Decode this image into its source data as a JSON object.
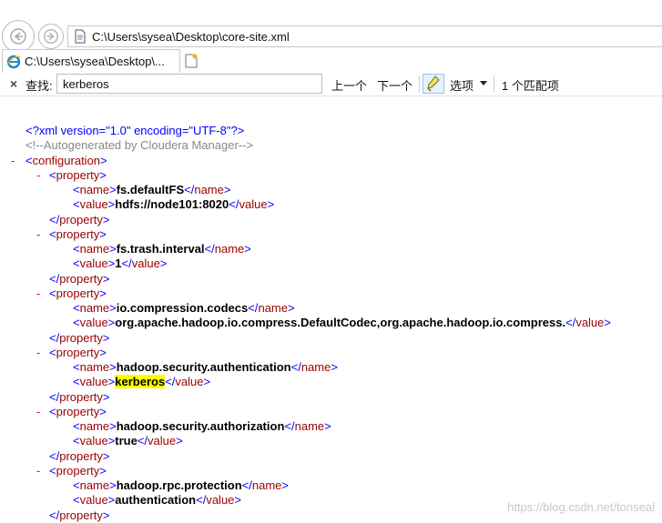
{
  "address_bar": {
    "url": "C:\\Users\\sysea\\Desktop\\core-site.xml"
  },
  "tab": {
    "title": "C:\\Users\\sysea\\Desktop\\..."
  },
  "find_bar": {
    "label": "查找:",
    "query": "kerberos",
    "prev_label": "上一个",
    "next_label": "下一个",
    "options_label": "选项",
    "match_count": "1 个匹配项"
  },
  "xml": {
    "declaration": "<?xml version=\"1.0\" encoding=\"UTF-8\"?>",
    "comment": "<!--Autogenerated by Cloudera Manager-->",
    "root_tag": "configuration",
    "element_tag": "property",
    "name_tag": "name",
    "value_tag": "value",
    "properties": [
      {
        "name": "fs.defaultFS",
        "value": "hdfs://node101:8020"
      },
      {
        "name": "fs.trash.interval",
        "value": "1"
      },
      {
        "name": "io.compression.codecs",
        "value": "org.apache.hadoop.io.compress.DefaultCodec,org.apache.hadoop.io.compress."
      },
      {
        "name": "hadoop.security.authentication",
        "value": "kerberos"
      },
      {
        "name": "hadoop.security.authorization",
        "value": "true"
      },
      {
        "name": "hadoop.rpc.protection",
        "value": "authentication"
      }
    ]
  },
  "watermark": "https://blog.csdn.net/tonseal",
  "colors": {
    "tag": "#990000",
    "bracket": "#0000ff",
    "comment": "#888888",
    "match": "#ffff00",
    "dash": "#ff0000"
  }
}
